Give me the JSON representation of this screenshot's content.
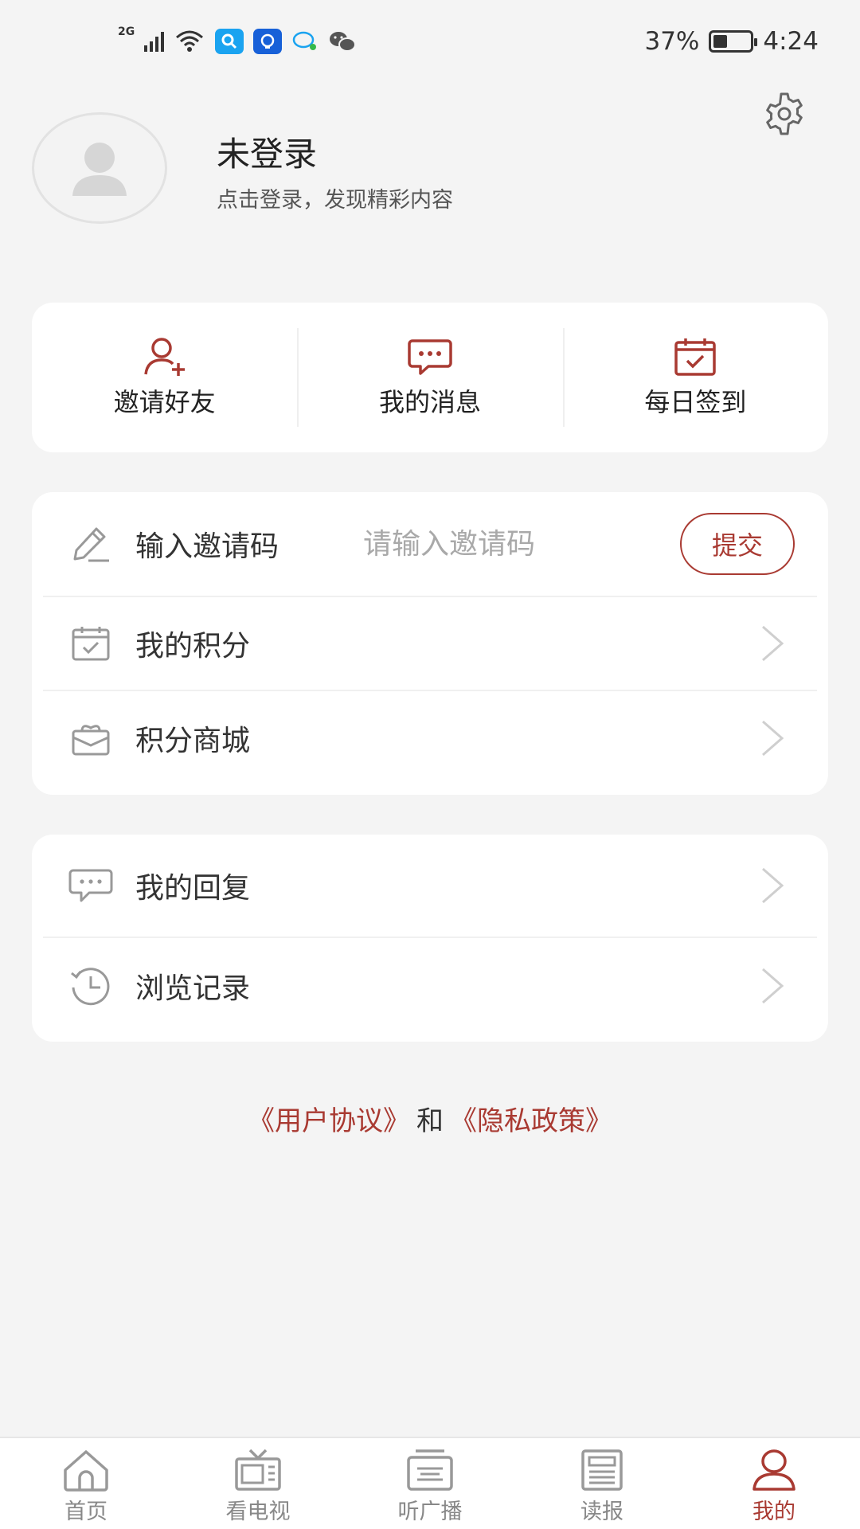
{
  "status_bar": {
    "network": "2G",
    "battery_percent": "37%",
    "battery_level": 0.37,
    "time": "4:24",
    "app_icons": [
      "search-app-icon",
      "browser-app-icon",
      "chat-bubble-app-icon",
      "wechat-icon"
    ]
  },
  "profile": {
    "name": "未登录",
    "subtitle": "点击登录，发现精彩内容"
  },
  "quick_actions": [
    {
      "label": "邀请好友",
      "icon": "add-user-icon"
    },
    {
      "label": "我的消息",
      "icon": "message-icon"
    },
    {
      "label": "每日签到",
      "icon": "calendar-check-icon"
    }
  ],
  "invite": {
    "label": "输入邀请码",
    "placeholder": "请输入邀请码",
    "submit_label": "提交"
  },
  "menu_group_1": [
    {
      "label": "我的积分",
      "icon": "calendar-check-icon"
    },
    {
      "label": "积分商城",
      "icon": "gift-box-icon"
    }
  ],
  "menu_group_2": [
    {
      "label": "我的回复",
      "icon": "comment-icon"
    },
    {
      "label": "浏览记录",
      "icon": "history-icon"
    }
  ],
  "legal": {
    "user_agreement": "《用户协议》",
    "and": "和",
    "privacy_policy": "《隐私政策》"
  },
  "bottom_nav": [
    {
      "label": "首页",
      "icon": "home-icon",
      "active": false
    },
    {
      "label": "看电视",
      "icon": "tv-icon",
      "active": false
    },
    {
      "label": "听广播",
      "icon": "radio-icon",
      "active": false
    },
    {
      "label": "读报",
      "icon": "newspaper-icon",
      "active": false
    },
    {
      "label": "我的",
      "icon": "user-icon",
      "active": true
    }
  ],
  "colors": {
    "accent": "#a93a32",
    "background": "#f4f4f4",
    "card": "#ffffff",
    "text_primary": "#333333",
    "text_muted": "#888888"
  }
}
